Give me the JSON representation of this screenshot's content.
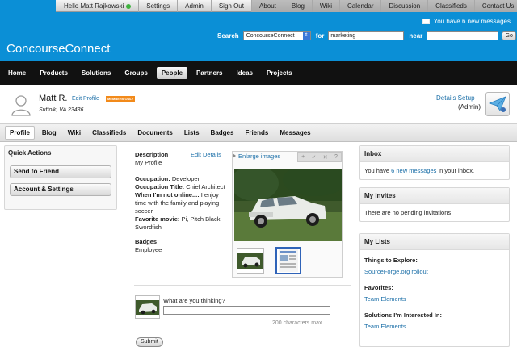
{
  "top_nav": {
    "greeting": "Hello Matt Rajkowski",
    "items": [
      "Settings",
      "Admin",
      "Sign Out",
      "About",
      "Blog",
      "Wiki",
      "Calendar",
      "Discussion",
      "Classifieds",
      "Contact Us"
    ]
  },
  "messages_note": {
    "prefix": "You have ",
    "link": "6 new messages"
  },
  "brand": {
    "logo": "ConcourseConnect"
  },
  "search": {
    "label": "Search",
    "scope": "ConcourseConnect",
    "for_label": "for",
    "for_value": "marketing",
    "near_label": "near",
    "near_value": "",
    "go_label": "Go"
  },
  "main_nav": {
    "items": [
      "Home",
      "Products",
      "Solutions",
      "Groups",
      "People",
      "Partners",
      "Ideas",
      "Projects"
    ],
    "active": "People"
  },
  "profile": {
    "name": "Matt R.",
    "edit_link": "Edit Profile",
    "badge": "MEMBERS ONLY",
    "location": "Suffolk, VA 23436",
    "details_setup": "Details Setup",
    "role": "(Admin)"
  },
  "profile_tabs": {
    "items": [
      "Profile",
      "Blog",
      "Wiki",
      "Classifieds",
      "Documents",
      "Lists",
      "Badges",
      "Friends",
      "Messages"
    ],
    "active": "Profile"
  },
  "quick_actions": {
    "title": "Quick Actions",
    "buttons": [
      "Send to Friend",
      "Account & Settings"
    ]
  },
  "description": {
    "title": "Description",
    "edit_link": "Edit Details",
    "text": "My Profile",
    "occupation_label": "Occupation:",
    "occupation_value": "Developer",
    "occupation_title_label": "Occupation Title:",
    "occupation_title_value": "Chief Architect",
    "not_online_label": "When I'm not online...:",
    "not_online_value": "I enjoy time with the family and playing soccer",
    "movie_label": "Favorite movie:",
    "movie_value": "Pi, Pitch Black, Swordfish",
    "badges_title": "Badges",
    "badges_value": "Employee"
  },
  "images": {
    "enlarge_link": "Enlarge images",
    "tools": [
      "+",
      "✓",
      "✕",
      "?"
    ]
  },
  "status": {
    "prompt": "What are you thinking?",
    "value": "",
    "char_max": "200 characters max",
    "submit": "Submit"
  },
  "inbox": {
    "title": "Inbox",
    "prefix": "You have ",
    "link": "6 new messages",
    "suffix": " in your inbox."
  },
  "invites": {
    "title": "My Invites",
    "text": "There are no pending invitations"
  },
  "lists": {
    "title": "My Lists",
    "groups": [
      {
        "label": "Things to Explore:",
        "item": "SourceForge.org rollout"
      },
      {
        "label": "Favorites:",
        "item": "Team Elements"
      },
      {
        "label": "Solutions I'm Interested In:",
        "item": "Team Elements"
      }
    ]
  },
  "colors": {
    "brand_blue": "#0b8fd6",
    "nav_black": "#111111",
    "link_blue": "#1b6fa8",
    "badge_orange": "#f28a1a"
  }
}
